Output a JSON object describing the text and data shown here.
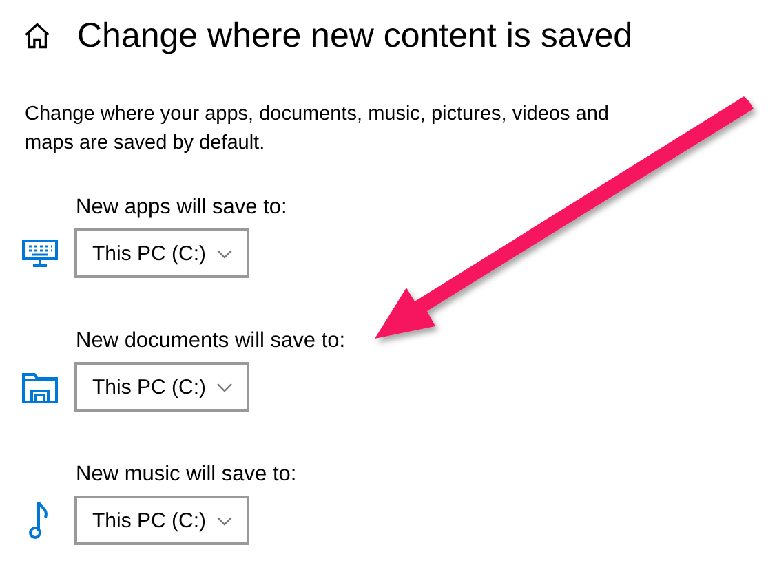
{
  "title": "Change where new content is saved",
  "description": "Change where your apps, documents, music, pictures, videos and maps are saved by default.",
  "locations": [
    {
      "label": "New apps will save to:",
      "value": "This PC (C:)"
    },
    {
      "label": "New documents will save to:",
      "value": "This PC (C:)"
    },
    {
      "label": "New music will save to:",
      "value": "This PC (C:)"
    }
  ]
}
